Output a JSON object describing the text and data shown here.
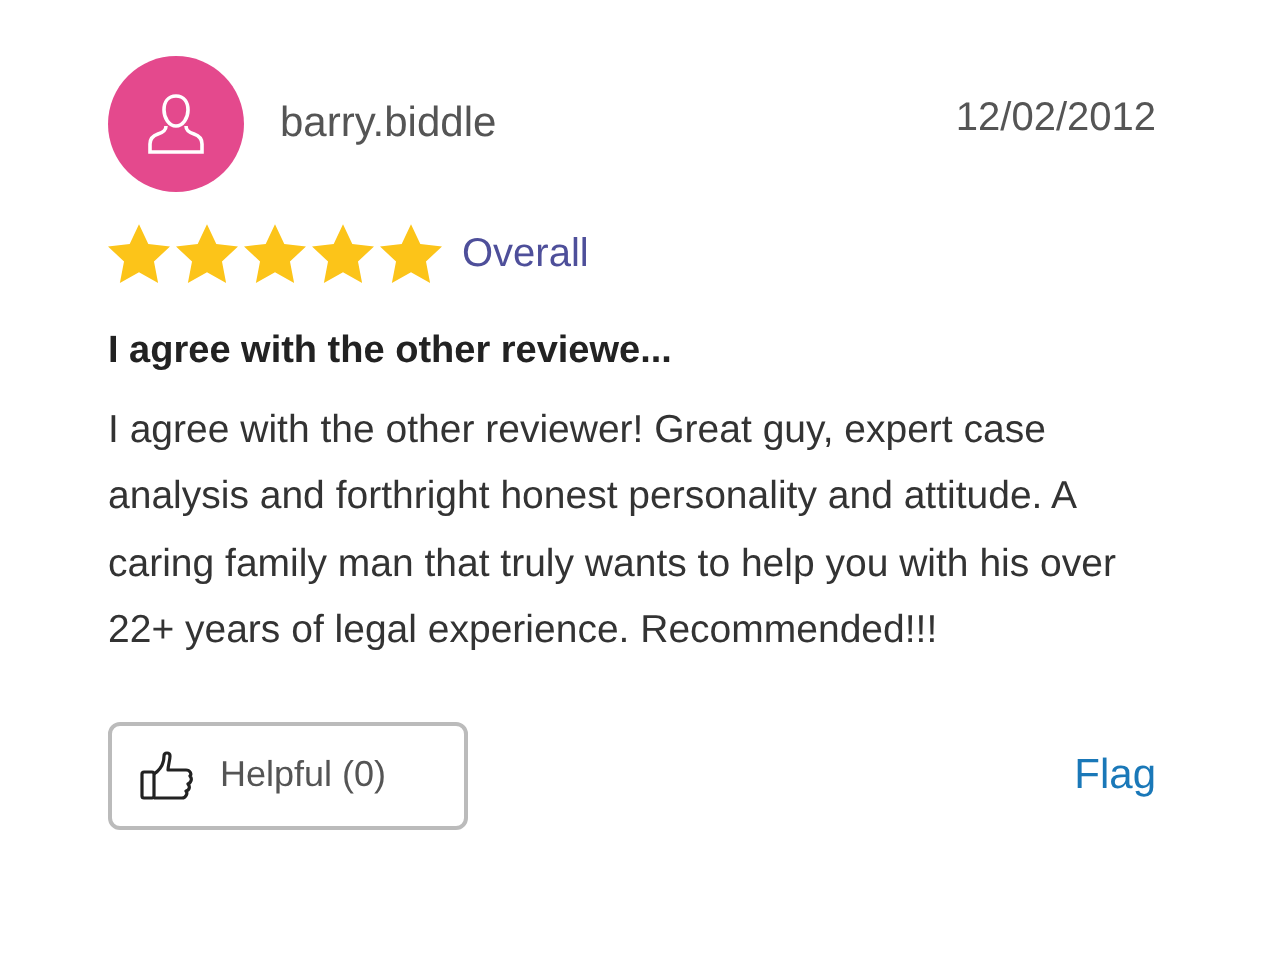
{
  "review": {
    "username": "barry.biddle",
    "date": "12/02/2012",
    "stars": 5,
    "rating_label": "Overall",
    "title": "I agree with the other reviewe...",
    "body": "I agree with the other reviewer! Great guy, expert case analysis and forthright honest personality and attitude. A caring family man that truly wants to help you with his over 22+ years of legal experience. Recommended!!!",
    "helpful_button": "Helpful (0)",
    "flag_link": "Flag"
  }
}
